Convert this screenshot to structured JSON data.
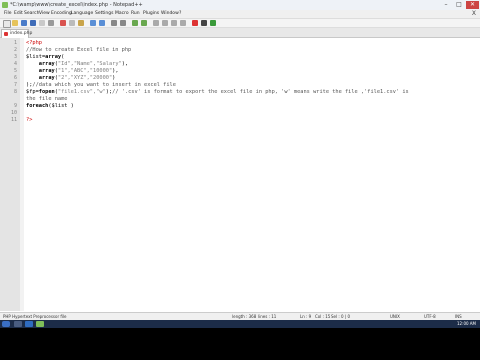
{
  "window": {
    "title": "*C:\\wamp\\www\\create_excel\\index.php - Notepad++",
    "minimize": "–",
    "maximize": "□",
    "close": "✕"
  },
  "menu": {
    "items": [
      "File",
      "Edit",
      "Search",
      "View",
      "Encoding",
      "Language",
      "Settings",
      "Macro",
      "Run",
      "Plugins",
      "Window",
      "?"
    ],
    "close": "X"
  },
  "tab": {
    "label": "index.php",
    "close": "x"
  },
  "editor": {
    "line_numbers": [
      "1",
      "2",
      "3",
      "4",
      "5",
      "6",
      "7",
      "8",
      "9",
      "10",
      "11"
    ]
  },
  "status": {
    "file_type": "PHP Hypertext Preprocessor file",
    "length": "length : 368",
    "lines": "lines : 11",
    "position": "Ln : 9",
    "column": "Col : 15",
    "selection": "Sel : 0 | 0",
    "eol": "UNIX",
    "encoding": "UTF-8",
    "mode": "INS"
  },
  "taskbar": {
    "clock": "12:00 AM"
  },
  "colors": {
    "php_tag": "#cc0000",
    "string": "#808080",
    "comment": "#555555",
    "taskbar": "#1c2c48",
    "gutter": "#e4e4e4"
  }
}
